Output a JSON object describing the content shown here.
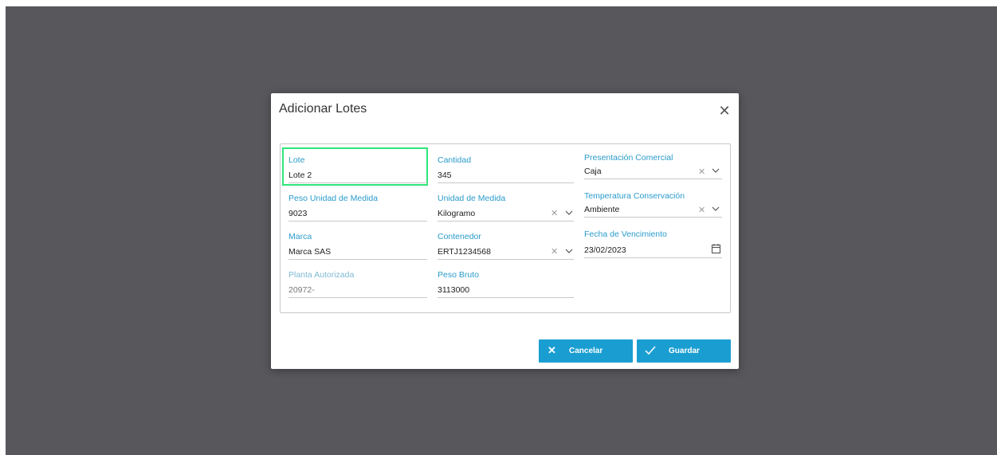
{
  "dialog": {
    "title": "Adicionar Lotes",
    "close_icon": "close-icon"
  },
  "form": {
    "lote": {
      "label": "Lote",
      "value": "Lote 2"
    },
    "cantidad": {
      "label": "Cantidad",
      "value": "345"
    },
    "presentacion": {
      "label": "Presentación Comercial",
      "value": "Caja"
    },
    "peso_unidad": {
      "label": "Peso Unidad de Medida",
      "value": "9023"
    },
    "unidad_medida": {
      "label": "Unidad de Medida",
      "value": "Kilogramo"
    },
    "temperatura": {
      "label": "Temperatura Conservación",
      "value": "Ambiente"
    },
    "marca": {
      "label": "Marca",
      "value": "Marca SAS"
    },
    "contenedor": {
      "label": "Contenedor",
      "value": "ERTJ1234568"
    },
    "fecha_vencimiento": {
      "label": "Fecha de Vencimiento",
      "value": "23/02/2023"
    },
    "planta_autorizada": {
      "label": "Planta Autorizada",
      "value": "20972-"
    },
    "peso_bruto": {
      "label": "Peso Bruto",
      "value": "3113000"
    }
  },
  "actions": {
    "cancel_label": "Cancelar",
    "save_label": "Guardar"
  },
  "colors": {
    "accent": "#1a9ed2",
    "label": "#2a9bcb",
    "focus": "#2ee67a",
    "backdrop": "#58575c"
  }
}
